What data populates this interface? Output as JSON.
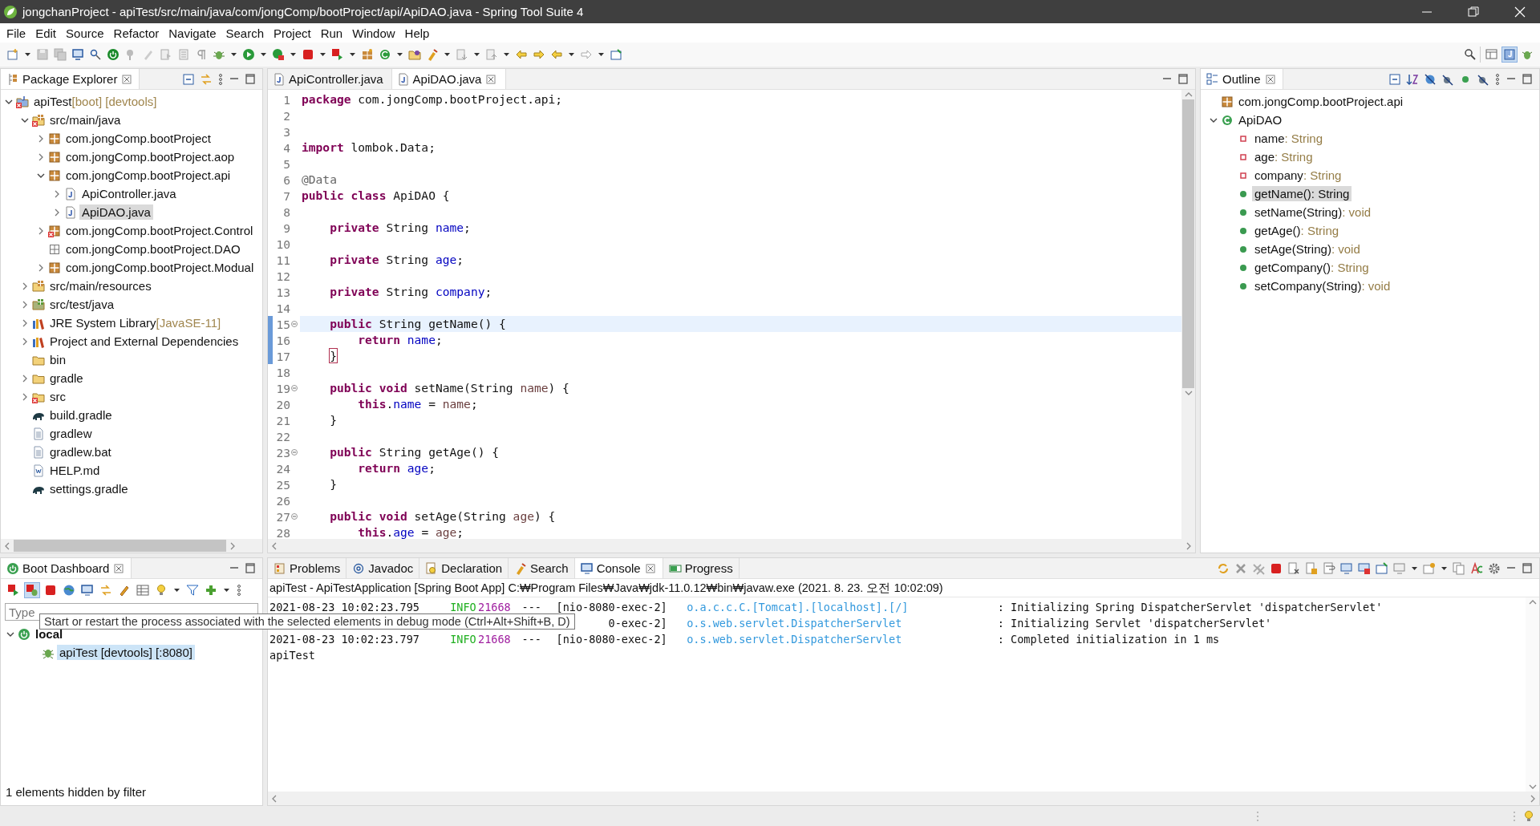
{
  "window": {
    "title": "jongchanProject - apiTest/src/main/java/com/jongComp/bootProject/api/ApiDAO.java - Spring Tool Suite 4"
  },
  "menu": [
    "File",
    "Edit",
    "Source",
    "Refactor",
    "Navigate",
    "Search",
    "Project",
    "Run",
    "Window",
    "Help"
  ],
  "package_explorer": {
    "title": "Package Explorer",
    "items": [
      {
        "label": "apiTest",
        "suffix": "[boot] [devtools]",
        "kind": "project",
        "error": true,
        "expanded": true,
        "selected": false,
        "children": [
          {
            "label": "src/main/java",
            "kind": "srcfolder",
            "error": true,
            "expanded": true,
            "selected": false,
            "children": [
              {
                "label": "com.jongComp.bootProject",
                "kind": "package",
                "error": false,
                "expanded": false,
                "selected": false
              },
              {
                "label": "com.jongComp.bootProject.aop",
                "kind": "package",
                "error": false,
                "expanded": false,
                "selected": false
              },
              {
                "label": "com.jongComp.bootProject.api",
                "kind": "package",
                "error": false,
                "expanded": true,
                "selected": false,
                "children": [
                  {
                    "label": "ApiController.java",
                    "kind": "java",
                    "error": false,
                    "expanded": false,
                    "selected": false
                  },
                  {
                    "label": "ApiDAO.java",
                    "kind": "java",
                    "error": false,
                    "expanded": false,
                    "selected": true
                  }
                ]
              },
              {
                "label": "com.jongComp.bootProject.Control",
                "kind": "package",
                "error": true,
                "expanded": false,
                "selected": false
              },
              {
                "label": "com.jongComp.bootProject.DAO",
                "kind": "emptypackage",
                "error": false,
                "selected": false
              },
              {
                "label": "com.jongComp.bootProject.Modual",
                "kind": "package",
                "error": false,
                "expanded": false,
                "selected": false
              }
            ]
          },
          {
            "label": "src/main/resources",
            "kind": "resfolder",
            "error": false,
            "expanded": false,
            "selected": false
          },
          {
            "label": "src/test/java",
            "kind": "testfolder",
            "error": false,
            "expanded": false,
            "selected": false
          },
          {
            "label": "JRE System Library",
            "suffix": "[JavaSE-11]",
            "kind": "library",
            "error": false,
            "expanded": false,
            "selected": false
          },
          {
            "label": "Project and External Dependencies",
            "kind": "library",
            "error": false,
            "expanded": false,
            "selected": false
          },
          {
            "label": "bin",
            "kind": "folder",
            "error": false,
            "selected": false
          },
          {
            "label": "gradle",
            "kind": "folder",
            "error": false,
            "expanded": false,
            "selected": false
          },
          {
            "label": "src",
            "kind": "folder",
            "error": true,
            "expanded": false,
            "selected": false
          },
          {
            "label": "build.gradle",
            "kind": "gradle",
            "error": false,
            "selected": false
          },
          {
            "label": "gradlew",
            "kind": "file",
            "error": false,
            "selected": false
          },
          {
            "label": "gradlew.bat",
            "kind": "file",
            "error": false,
            "selected": false
          },
          {
            "label": "HELP.md",
            "kind": "doc",
            "error": false,
            "selected": false
          },
          {
            "label": "settings.gradle",
            "kind": "gradle",
            "error": false,
            "selected": false
          }
        ]
      }
    ]
  },
  "editor": {
    "tabs": [
      {
        "label": "ApiController.java",
        "selected": false
      },
      {
        "label": "ApiDAO.java",
        "selected": true
      }
    ],
    "lines": [
      {
        "n": "1",
        "current": false,
        "fold": false,
        "changed": false,
        "tokens": [
          {
            "kind": "kw",
            "text": "package"
          },
          {
            "kind": "p",
            "text": " com.jongComp.bootProject.api;"
          }
        ]
      },
      {
        "n": "2",
        "current": false,
        "fold": false,
        "changed": false
      },
      {
        "n": "3",
        "current": false,
        "fold": false,
        "changed": false
      },
      {
        "n": "4",
        "current": false,
        "fold": false,
        "changed": false,
        "tokens": [
          {
            "kind": "kw",
            "text": "import"
          },
          {
            "kind": "p",
            "text": " lombok.Data;"
          }
        ]
      },
      {
        "n": "5",
        "current": false,
        "fold": false,
        "changed": false
      },
      {
        "n": "6",
        "current": false,
        "fold": false,
        "changed": false,
        "tokens": [
          {
            "kind": "ann",
            "text": "@Data"
          }
        ]
      },
      {
        "n": "7",
        "current": false,
        "fold": false,
        "changed": false,
        "tokens": [
          {
            "kind": "kw",
            "text": "public class"
          },
          {
            "kind": "p",
            "text": " ApiDAO {"
          }
        ]
      },
      {
        "n": "8",
        "current": false,
        "fold": false,
        "changed": false
      },
      {
        "n": "9",
        "current": false,
        "fold": false,
        "changed": false,
        "tokens": [
          {
            "kind": "kw",
            "text": "    private"
          },
          {
            "kind": "p",
            "text": " String "
          },
          {
            "kind": "fld",
            "text": "name"
          },
          {
            "kind": "p",
            "text": ";"
          }
        ]
      },
      {
        "n": "10",
        "current": false,
        "fold": false,
        "changed": false
      },
      {
        "n": "11",
        "current": false,
        "fold": false,
        "changed": false,
        "tokens": [
          {
            "kind": "kw",
            "text": "    private"
          },
          {
            "kind": "p",
            "text": " String "
          },
          {
            "kind": "fld",
            "text": "age"
          },
          {
            "kind": "p",
            "text": ";"
          }
        ]
      },
      {
        "n": "12",
        "current": false,
        "fold": false,
        "changed": false
      },
      {
        "n": "13",
        "current": false,
        "fold": false,
        "changed": false,
        "tokens": [
          {
            "kind": "kw",
            "text": "    private"
          },
          {
            "kind": "p",
            "text": " String "
          },
          {
            "kind": "fld",
            "text": "company"
          },
          {
            "kind": "p",
            "text": ";"
          }
        ]
      },
      {
        "n": "14",
        "current": false,
        "fold": false,
        "changed": false
      },
      {
        "n": "15",
        "current": true,
        "fold": true,
        "changed": true,
        "tokens": [
          {
            "kind": "kw",
            "text": "    public"
          },
          {
            "kind": "p",
            "text": " String getName() {"
          }
        ]
      },
      {
        "n": "16",
        "current": false,
        "fold": false,
        "changed": true,
        "tokens": [
          {
            "kind": "kw",
            "text": "        return"
          },
          {
            "kind": "fld",
            "text": " name"
          },
          {
            "kind": "p",
            "text": ";"
          }
        ]
      },
      {
        "n": "17",
        "current": false,
        "fold": false,
        "changed": true,
        "tokens": [
          {
            "kind": "match",
            "text": "    }"
          }
        ]
      },
      {
        "n": "18",
        "current": false,
        "fold": false,
        "changed": false
      },
      {
        "n": "19",
        "current": false,
        "fold": true,
        "changed": false,
        "tokens": [
          {
            "kind": "kw",
            "text": "    public void"
          },
          {
            "kind": "p",
            "text": " setName(String "
          },
          {
            "kind": "par",
            "text": "name"
          },
          {
            "kind": "p",
            "text": ") {"
          }
        ]
      },
      {
        "n": "20",
        "current": false,
        "fold": false,
        "changed": false,
        "tokens": [
          {
            "kind": "kw",
            "text": "        this"
          },
          {
            "kind": "p",
            "text": "."
          },
          {
            "kind": "fld",
            "text": "name"
          },
          {
            "kind": "p",
            "text": " = "
          },
          {
            "kind": "par",
            "text": "name"
          },
          {
            "kind": "p",
            "text": ";"
          }
        ]
      },
      {
        "n": "21",
        "current": false,
        "fold": false,
        "changed": false,
        "tokens": [
          {
            "kind": "p",
            "text": "    }"
          }
        ]
      },
      {
        "n": "22",
        "current": false,
        "fold": false,
        "changed": false
      },
      {
        "n": "23",
        "current": false,
        "fold": true,
        "changed": false,
        "tokens": [
          {
            "kind": "kw",
            "text": "    public"
          },
          {
            "kind": "p",
            "text": " String getAge() {"
          }
        ]
      },
      {
        "n": "24",
        "current": false,
        "fold": false,
        "changed": false,
        "tokens": [
          {
            "kind": "kw",
            "text": "        return"
          },
          {
            "kind": "fld",
            "text": " age"
          },
          {
            "kind": "p",
            "text": ";"
          }
        ]
      },
      {
        "n": "25",
        "current": false,
        "fold": false,
        "changed": false,
        "tokens": [
          {
            "kind": "p",
            "text": "    }"
          }
        ]
      },
      {
        "n": "26",
        "current": false,
        "fold": false,
        "changed": false
      },
      {
        "n": "27",
        "current": false,
        "fold": true,
        "changed": false,
        "tokens": [
          {
            "kind": "kw",
            "text": "    public void"
          },
          {
            "kind": "p",
            "text": " setAge(String "
          },
          {
            "kind": "par",
            "text": "age"
          },
          {
            "kind": "p",
            "text": ") {"
          }
        ]
      },
      {
        "n": "28",
        "current": false,
        "fold": false,
        "changed": false,
        "tokens": [
          {
            "kind": "kw",
            "text": "        this"
          },
          {
            "kind": "p",
            "text": "."
          },
          {
            "kind": "fld",
            "text": "age"
          },
          {
            "kind": "p",
            "text": " = "
          },
          {
            "kind": "par",
            "text": "age"
          },
          {
            "kind": "p",
            "text": ";"
          }
        ]
      }
    ]
  },
  "outline": {
    "title": "Outline",
    "items": [
      {
        "label": "com.jongComp.bootProject.api",
        "kind": "package",
        "selected": false
      },
      {
        "label": "ApiDAO",
        "kind": "class",
        "expanded": true,
        "selected": false,
        "children": [
          {
            "label": "name",
            "type": ": String",
            "kind": "field",
            "selected": false
          },
          {
            "label": "age",
            "type": ": String",
            "kind": "field",
            "selected": false
          },
          {
            "label": "company",
            "type": ": String",
            "kind": "field",
            "selected": false
          },
          {
            "label": "getName()",
            "type": ": String",
            "kind": "method",
            "selected": true
          },
          {
            "label": "setName(String)",
            "type": ": void",
            "kind": "method",
            "selected": false
          },
          {
            "label": "getAge()",
            "type": ": String",
            "kind": "method",
            "selected": false
          },
          {
            "label": "setAge(String)",
            "type": ": void",
            "kind": "method",
            "selected": false
          },
          {
            "label": "getCompany()",
            "type": ": String",
            "kind": "method",
            "selected": false
          },
          {
            "label": "setCompany(String)",
            "type": ": void",
            "kind": "method",
            "selected": false
          }
        ]
      }
    ]
  },
  "boot_dashboard": {
    "title": "Boot Dashboard",
    "filter": {
      "placeholder": "Type"
    },
    "items": [
      {
        "label": "local",
        "kind": "target",
        "expanded": true,
        "selected": false,
        "children": [
          {
            "label": "apiTest [devtools] [:8080]",
            "kind": "app",
            "selected": true
          }
        ]
      }
    ],
    "footer": "1 elements hidden by filter",
    "tooltip": "Start or restart the process associated with the selected elements in debug mode (Ctrl+Alt+Shift+B, D)"
  },
  "console": {
    "tabs": [
      {
        "label": "Problems",
        "selected": false
      },
      {
        "label": "Javadoc",
        "selected": false
      },
      {
        "label": "Declaration",
        "selected": false
      },
      {
        "label": "Search",
        "selected": false
      },
      {
        "label": "Console",
        "selected": true
      },
      {
        "label": "Progress",
        "selected": false
      }
    ],
    "description": "apiTest - ApiTestApplication [Spring Boot App] C:₩Program Files₩Java₩jdk-11.0.12₩bin₩javaw.exe  (2021. 8. 23. 오전 10:02:09)",
    "lines": [
      {
        "kind": "log",
        "time": "2021-08-23 10:02:23.795",
        "level": "INFO",
        "pid": "21668",
        "sep": "---",
        "thread": "[nio-8080-exec-2]",
        "logger": "o.a.c.c.C.[Tomcat].[localhost].[/]",
        "message": ": Initializing Spring DispatcherServlet 'dispatcherServlet'"
      },
      {
        "kind": "log",
        "thread": "0-exec-2]",
        "logger": "o.s.web.servlet.DispatcherServlet",
        "message": ": Initializing Servlet 'dispatcherServlet'"
      },
      {
        "kind": "log",
        "time": "2021-08-23 10:02:23.797",
        "level": "INFO",
        "pid": "21668",
        "sep": "---",
        "thread": "[nio-8080-exec-2]",
        "logger": "o.s.web.servlet.DispatcherServlet",
        "message": ": Completed initialization in 1 ms"
      },
      {
        "kind": "plain",
        "text": "apiTest"
      }
    ]
  }
}
